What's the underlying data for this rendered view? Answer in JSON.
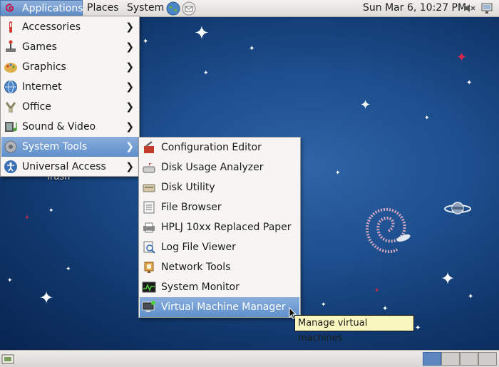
{
  "top_panel": {
    "applications_label": "Applications",
    "places_label": "Places",
    "system_label": "System",
    "clock": "Sun Mar  6, 10:27 PM"
  },
  "desktop": {
    "trash_label": "Trash"
  },
  "main_menu": {
    "items": [
      {
        "label": "Accessories",
        "icon": "accessories-icon"
      },
      {
        "label": "Games",
        "icon": "games-icon"
      },
      {
        "label": "Graphics",
        "icon": "graphics-icon"
      },
      {
        "label": "Internet",
        "icon": "internet-icon"
      },
      {
        "label": "Office",
        "icon": "office-icon"
      },
      {
        "label": "Sound & Video",
        "icon": "sound-video-icon"
      },
      {
        "label": "System Tools",
        "icon": "system-tools-icon",
        "active": true
      },
      {
        "label": "Universal Access",
        "icon": "universal-access-icon"
      }
    ]
  },
  "system_tools_menu": {
    "items": [
      {
        "label": "Configuration Editor",
        "icon": "configuration-editor-icon"
      },
      {
        "label": "Disk Usage Analyzer",
        "icon": "disk-usage-icon"
      },
      {
        "label": "Disk Utility",
        "icon": "disk-utility-icon"
      },
      {
        "label": "File Browser",
        "icon": "file-browser-icon"
      },
      {
        "label": "HPLJ 10xx Replaced Paper",
        "icon": "printer-icon"
      },
      {
        "label": "Log File Viewer",
        "icon": "log-viewer-icon"
      },
      {
        "label": "Network Tools",
        "icon": "network-tools-icon"
      },
      {
        "label": "System Monitor",
        "icon": "system-monitor-icon"
      },
      {
        "label": "Virtual Machine Manager",
        "icon": "virtual-machine-icon",
        "active": true
      }
    ]
  },
  "tooltip": {
    "text": "Manage virtual machines"
  },
  "colors": {
    "accent": "#5f8fcb",
    "desktop_bg": "#1e4f8f",
    "tooltip_bg": "#f9f6bf"
  }
}
